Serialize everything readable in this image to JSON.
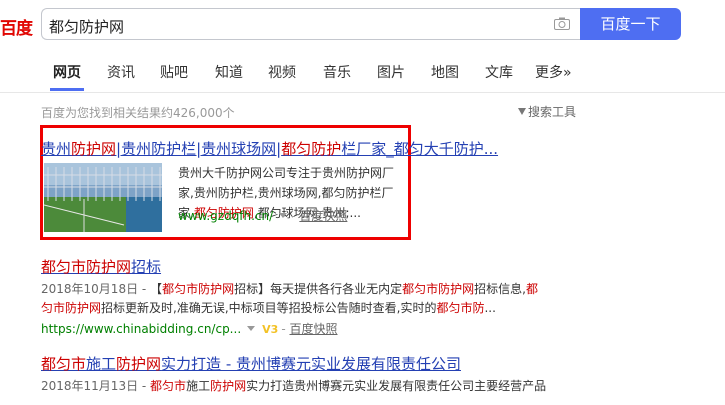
{
  "logo": "百度",
  "search": {
    "query": "都匀防护网",
    "button": "百度一下"
  },
  "tabs": [
    "网页",
    "资讯",
    "贴吧",
    "知道",
    "视频",
    "音乐",
    "图片",
    "地图",
    "文库",
    "更多»"
  ],
  "result_count": "百度为您找到相关结果约426,000个",
  "tools": "搜索工具",
  "r1": {
    "t1": "贵州",
    "t2": "防护网",
    "t3": "|贵州防护栏|贵州球场网|",
    "t4": "都匀防护",
    "t5": "栏厂家_都匀大千防护...",
    "a1": "贵州大千防护网公司专注于贵州防护网厂家,贵州防护栏,贵州球场网,都匀防护栏厂家,",
    "a2": "都匀防护网",
    "a3": ",都匀球场网,贵州;...",
    "url": "www.gzdqfh.cn/",
    "snap": "百度快照"
  },
  "r2": {
    "t1": "都匀市防护网",
    "t2": "招标",
    "date": "2018年10月18日 - ",
    "s1": "【",
    "s2": "都匀市防护网",
    "s3": "招标】每天提供各行各业无内定",
    "s4": "都匀市防护网",
    "s5": "招标信息,",
    "s6": "都",
    "s7": "匀市防护网",
    "s8": "招标更新及时,准确无误,中标项目等招投标公告随时查看,实时的",
    "s9": "都匀市防",
    "url": "https://www.chinabidding.cn/cp...",
    "v": "V3",
    "snap": "百度快照"
  },
  "r3": {
    "t1": "都匀市",
    "t2": "施工",
    "t3": "防护网",
    "t4": "实力打造 - 贵州博赛元实业发展有限责任公司",
    "date": "2018年11月13日 - ",
    "s1": "都匀市",
    "s2": "施工",
    "s3": "防护网",
    "s4": "实力打造贵州博赛元实业发展有限责任公司主要经营产品"
  },
  "colors": {
    "accent": "#4e6ef2",
    "link": "#2440b3",
    "highlight": "#c00",
    "url": "#008000",
    "box": "#ee0000"
  }
}
